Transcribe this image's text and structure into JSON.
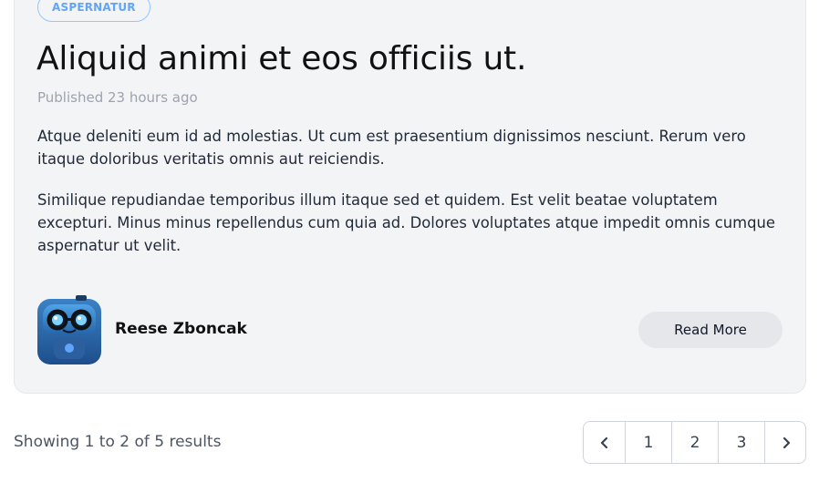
{
  "post": {
    "tag": "ASPERNATUR",
    "title": "Aliquid animi et eos officiis ut.",
    "published": "Published 23 hours ago",
    "paragraphs": [
      "Atque deleniti eum id ad molestias. Ut cum est praesentium dignissimos nesciunt. Rerum vero itaque doloribus veritatis omnis aut reiciendis.",
      "Similique repudiandae temporibus illum itaque sed et quidem. Est velit beatae voluptatem excepturi. Minus minus repellendus cum quia ad. Dolores voluptates atque impedit omnis cumque aspernatur ut velit."
    ],
    "author": "Reese Zboncak",
    "read_more_label": "Read More"
  },
  "pagination": {
    "summary": "Showing 1 to 2 of 5 results",
    "pages": [
      "1",
      "2",
      "3"
    ],
    "prev_icon": "chevron-left-icon",
    "next_icon": "chevron-right-icon"
  },
  "colors": {
    "card_bg": "#f3f4f6",
    "tag_color": "#60a5fa",
    "button_bg": "#e5e7eb"
  }
}
